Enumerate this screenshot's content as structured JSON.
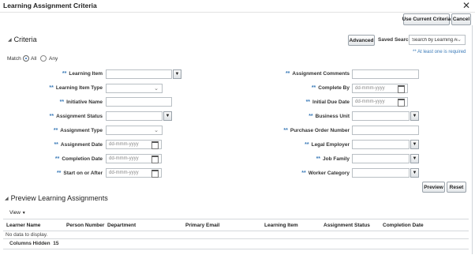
{
  "dialog": {
    "title": "Learning Assignment Criteria"
  },
  "toolbar": {
    "use_current": "Use Current Criteria",
    "cancel": "Cancel"
  },
  "criteria": {
    "title": "Criteria",
    "advanced": "Advanced",
    "saved_search_label": "Saved Search",
    "saved_search_value": "Search by Learning Ar",
    "required_note": "** At least one is required",
    "match_label": "Match",
    "match_all": "All",
    "match_any": "Any",
    "req_mark": "**",
    "date_placeholder": "dd-mmm-yyyy",
    "left": {
      "learning_item": "Learning Item",
      "learning_item_type": "Learning Item Type",
      "initiative_name": "Initiative Name",
      "assignment_status": "Assignment Status",
      "assignment_type": "Assignment Type",
      "assignment_date": "Assignment Date",
      "completion_date": "Completion Date",
      "start_on_after": "Start on or After"
    },
    "right": {
      "assignment_comments": "Assignment Comments",
      "complete_by": "Complete By",
      "initial_due_date": "Initial Due Date",
      "business_unit": "Business Unit",
      "purchase_order_number": "Purchase Order Number",
      "legal_employer": "Legal Employer",
      "job_family": "Job Family",
      "worker_category": "Worker Category"
    },
    "preview": "Preview",
    "reset": "Reset"
  },
  "preview_section": {
    "title": "Preview Learning Assignments",
    "view": "View",
    "columns": [
      "Learner Name",
      "Person Number",
      "Department",
      "Primary Email",
      "Learning Item",
      "Assignment Status",
      "Completion Date"
    ],
    "empty_text": "No data to display.",
    "columns_hidden_label": "Columns Hidden",
    "columns_hidden_count": "15"
  }
}
